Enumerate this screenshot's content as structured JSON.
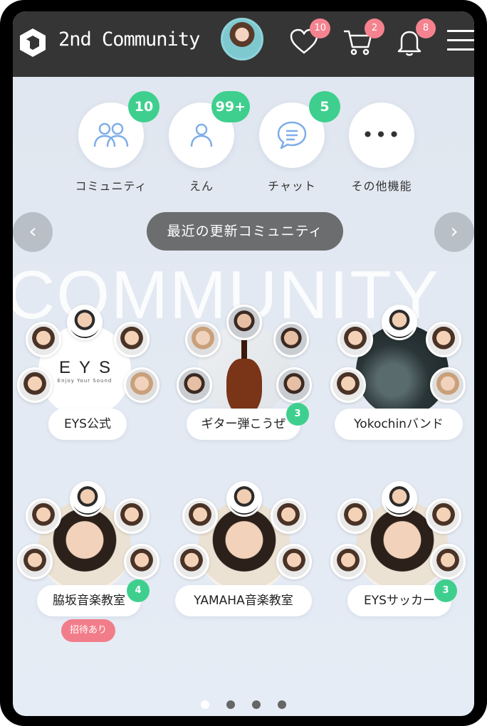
{
  "header": {
    "app_name": "2nd Community",
    "favorites_badge": "10",
    "cart_badge": "2",
    "notifications_badge": "8"
  },
  "features": [
    {
      "label": "コミュニティ",
      "badge": "10",
      "icon": "people-icon"
    },
    {
      "label": "えん",
      "badge": "99+",
      "icon": "person-icon"
    },
    {
      "label": "チャット",
      "badge": "5",
      "icon": "chat-bubble-icon"
    },
    {
      "label": "その他機能",
      "badge": "",
      "icon": "more-dots-icon"
    }
  ],
  "section": {
    "title": "最近の更新コミュニティ",
    "watermark": "COMMUNITY"
  },
  "communities": [
    {
      "name": "EYS公式",
      "badge": "",
      "center": "EYS logo",
      "logo_text": "EYS",
      "logo_sub": "Enjoy Your Sound"
    },
    {
      "name": "ギター弾こうぜ",
      "badge": "3",
      "center": "violin"
    },
    {
      "name": "Yokochinバンド",
      "badge": "",
      "center": "band"
    },
    {
      "name": "脇坂音楽教室",
      "badge": "4",
      "invite": "招待あり",
      "center": "teacher"
    },
    {
      "name": "YAMAHA音楽教室",
      "badge": "",
      "center": "teacher"
    },
    {
      "name": "EYSサッカー",
      "badge": "3",
      "center": "teacher"
    }
  ],
  "pagination": {
    "total": 4,
    "active": 1
  },
  "colors": {
    "header_bg": "#353535",
    "badge_green": "#3ecf8e",
    "badge_pink": "#f5838f",
    "pill_grey": "#6c6d6e"
  }
}
